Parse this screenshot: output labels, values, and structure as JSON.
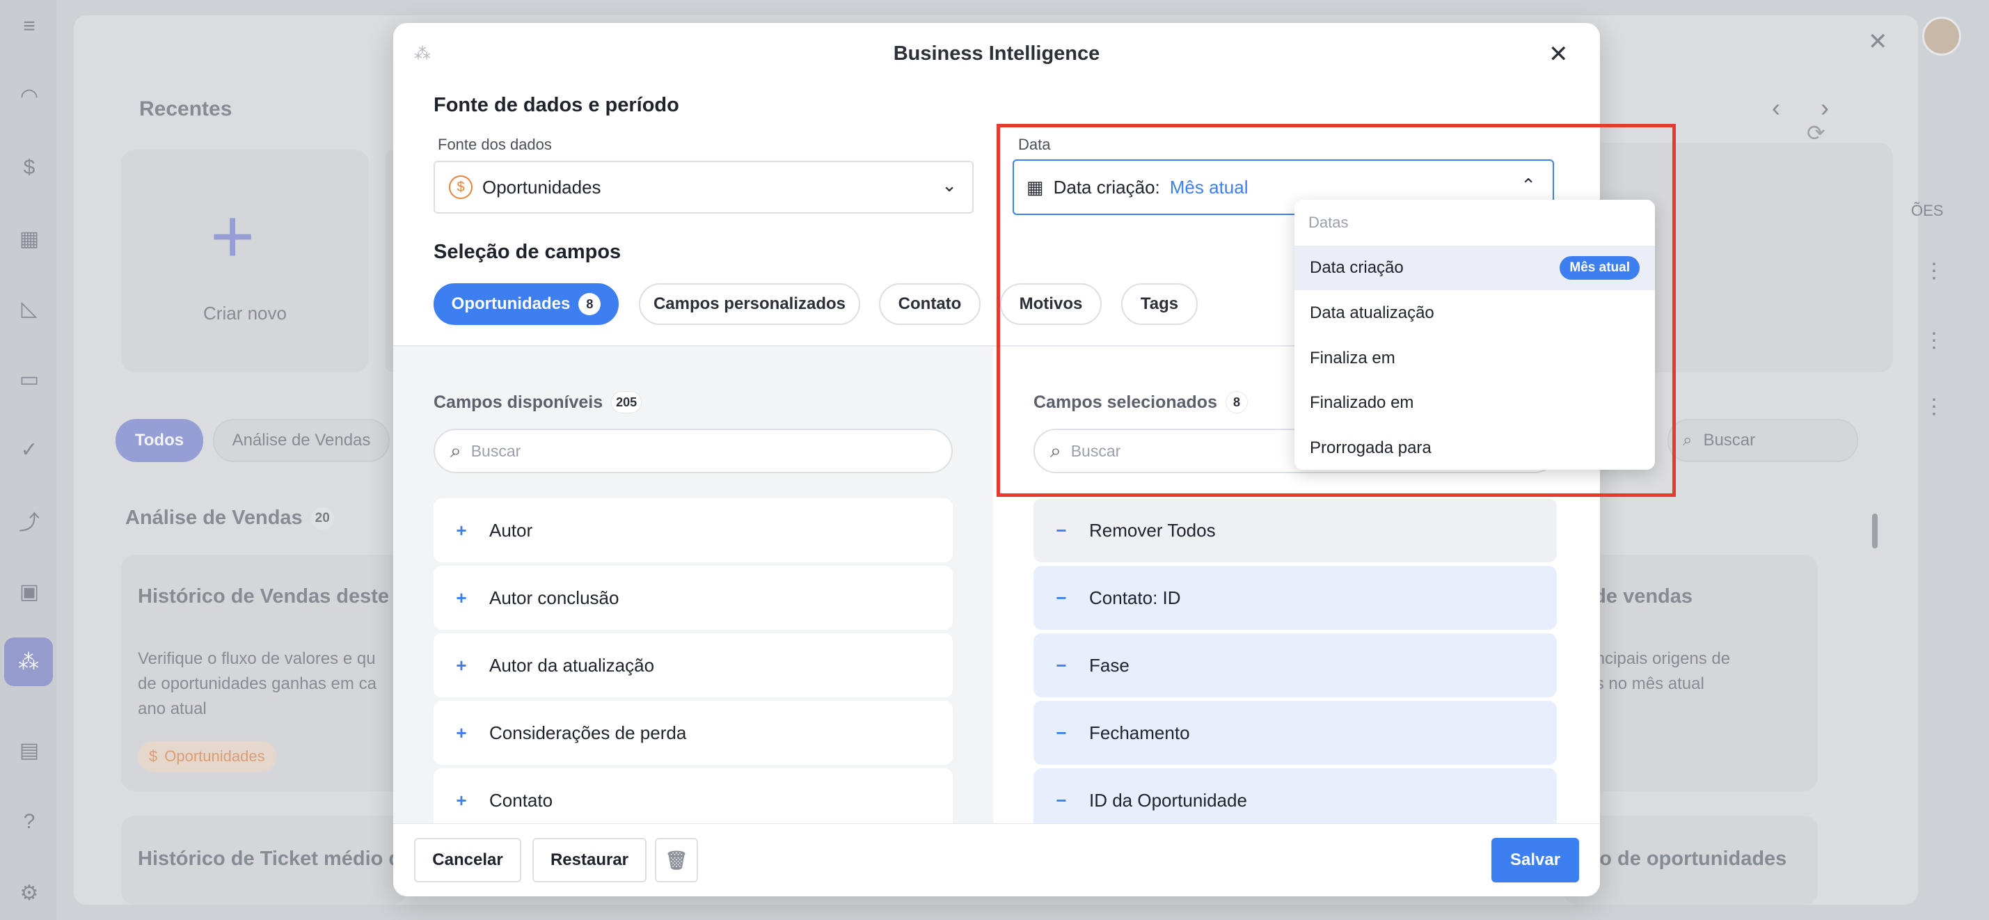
{
  "background": {
    "recentes_title": "Recentes",
    "criar_novo": "Criar novo",
    "filter_todos": "Todos",
    "filter_analise": "Análise de Vendas",
    "section_title": "Análise de Vendas",
    "section_count": "20",
    "card1_title": "Histórico de Vendas deste a",
    "card1_desc_line1": "Verifique o fluxo de valores e qu",
    "card1_desc_line2": "de oportunidades ganhas em ca",
    "card1_desc_line3": "ano atual",
    "card1_tag": "Oportunidades",
    "card2_title_fragment": "s de vendas",
    "card2_desc_line1": "principais origens de",
    "card2_desc_line2": "has no mês atual",
    "bottom_left_title": "Histórico de Ticket médio de",
    "bottom_right_title": "ção de oportunidades",
    "right_search_placeholder": "Buscar",
    "column_fragment": "ÕES"
  },
  "modal": {
    "title": "Business Intelligence",
    "section_source": "Fonte de dados e período",
    "source_label": "Fonte dos dados",
    "source_value": "Oportunidades",
    "date_label": "Data",
    "date_field_name": "Data criação:",
    "date_field_value": "Mês atual",
    "section_fields": "Seleção de campos",
    "tabs": [
      {
        "label": "Oportunidades",
        "count": "8"
      },
      {
        "label": "Campos personalizados"
      },
      {
        "label": "Contato"
      },
      {
        "label": "Motivos"
      },
      {
        "label": "Tags"
      }
    ],
    "available_title": "Campos disponíveis",
    "available_count": "205",
    "available_search_placeholder": "Buscar",
    "available_fields": [
      "Autor",
      "Autor conclusão",
      "Autor da atualização",
      "Considerações de perda",
      "Contato"
    ],
    "selected_title": "Campos selecionados",
    "selected_count": "8",
    "selected_search_placeholder": "Buscar",
    "remove_all": "Remover Todos",
    "selected_fields": [
      "Contato: ID",
      "Fase",
      "Fechamento",
      "ID da Oportunidade"
    ],
    "buttons": {
      "cancel": "Cancelar",
      "restore": "Restaurar",
      "save": "Salvar"
    }
  },
  "dropdown": {
    "header": "Datas",
    "items": [
      {
        "label": "Data criação",
        "badge": "Mês atual"
      },
      {
        "label": "Data atualização"
      },
      {
        "label": "Finaliza em"
      },
      {
        "label": "Finalizado em"
      },
      {
        "label": "Prorrogada para"
      }
    ]
  },
  "colors": {
    "accent": "#3d7ef0",
    "highlight": "#e53a2f",
    "orange": "#e8833a"
  },
  "icons": [
    "menu-icon",
    "dashboard-icon",
    "dollar-icon",
    "building-icon",
    "chart-icon",
    "calendar-icon",
    "check-icon",
    "trend-icon",
    "widgets-icon",
    "bi-icon",
    "chat-icon",
    "help-icon",
    "settings-icon"
  ]
}
